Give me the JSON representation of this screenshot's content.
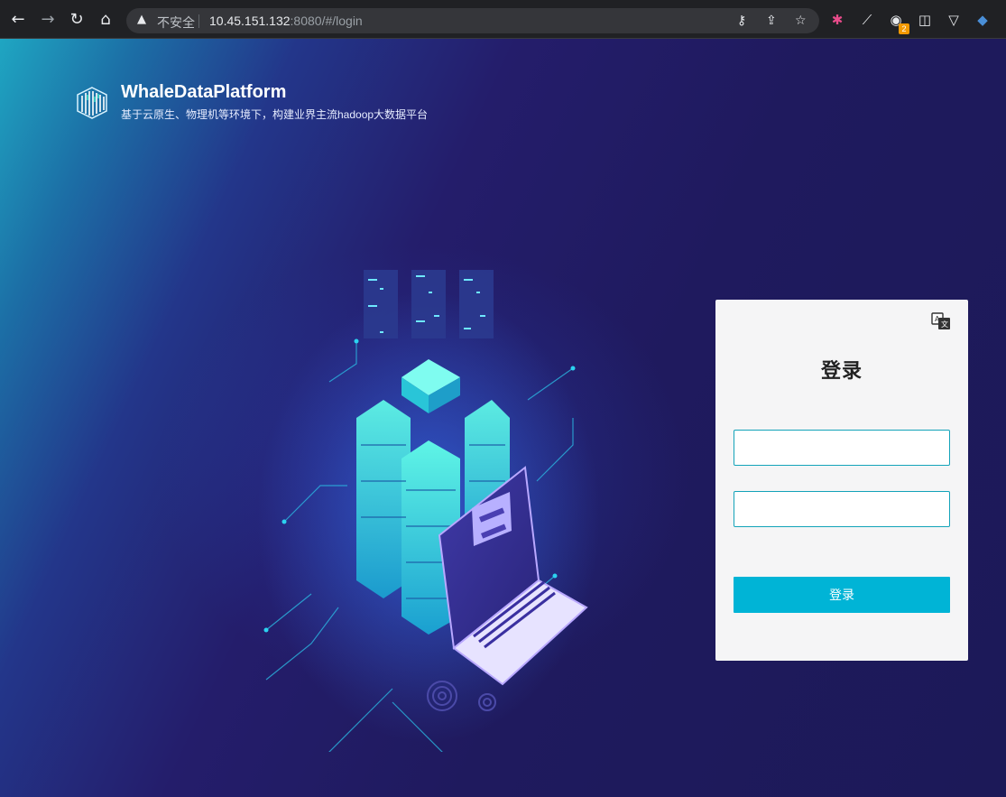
{
  "browser": {
    "back_icon": "arrow-left-icon",
    "forward_icon": "arrow-right-icon",
    "reload_icon": "reload-icon",
    "home_icon": "home-icon",
    "security_label": "不安全",
    "url_host": "10.45.151.132",
    "url_rest": ":8080/#/login",
    "extension_badge": "2"
  },
  "brand": {
    "name": "WhaleDataPlatform",
    "subtitle": "基于云原生、物理机等环境下，构建业界主流hadoop大数据平台"
  },
  "login": {
    "title": "登录",
    "username_value": "",
    "password_value": "",
    "button_label": "登录",
    "language_icon": "translate-icon"
  },
  "colors": {
    "accent": "#00b4d6",
    "input_border": "#13a3b9",
    "card_bg": "#f5f5f6",
    "page_bg": "#1e1a5c"
  }
}
